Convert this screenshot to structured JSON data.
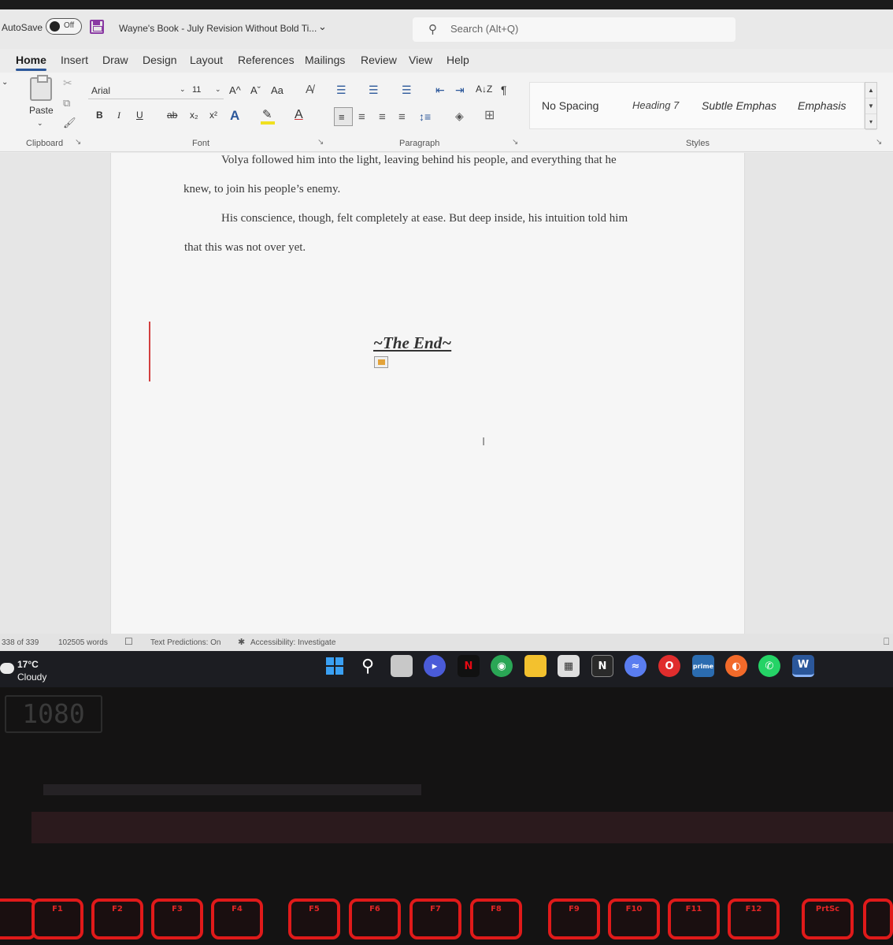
{
  "titlebar": {
    "autosave_label": "AutoSave",
    "autosave_state": "Off",
    "doc_title": "Wayne's Book - July Revision Without Bold Ti...",
    "title_chevron": "⌄",
    "search_placeholder": "Search (Alt+Q)"
  },
  "menu": [
    "Home",
    "Insert",
    "Draw",
    "Design",
    "Layout",
    "References",
    "Mailings",
    "Review",
    "View",
    "Help"
  ],
  "ribbon": {
    "paste_label": "Paste",
    "clipboard_label": "Clipboard",
    "font_name": "Arial",
    "font_size": "11",
    "font_label": "Font",
    "paragraph_label": "Paragraph",
    "styles_label": "Styles",
    "grow_font": "A^",
    "shrink_font": "Aˇ",
    "change_case": "Aa",
    "bold": "B",
    "italic": "I",
    "underline": "U",
    "strikethrough": "ab",
    "subscript": "x₂",
    "superscript": "x²",
    "text_effects": "A",
    "font_color": "A",
    "pilcrow": "¶",
    "sort": "A↓Z",
    "styles": [
      "No Spacing",
      "Heading 7",
      "Subtle Emphas",
      "Emphasis"
    ]
  },
  "document": {
    "line1": "Volya followed him into the light, leaving behind his people, and everything that he",
    "line2": "knew, to join his people’s enemy.",
    "line3": "His conscience, though, felt completely at ease. But deep inside, his intuition told him",
    "line4": "that this was not over yet.",
    "the_end": "~The End~"
  },
  "status": {
    "page": "338 of 339",
    "words": "102505 words",
    "predictions": "Text Predictions: On",
    "accessibility": "Accessibility: Investigate"
  },
  "taskbar": {
    "temp": "17°C",
    "condition": "Cloudy"
  },
  "led_display": "1080",
  "keyboard_keys": [
    "F1",
    "F2",
    "F3",
    "F4",
    "F5",
    "F6",
    "F7",
    "F8",
    "F9",
    "F10",
    "F11",
    "F12",
    "PrtSc"
  ],
  "colors": {
    "word_blue": "#2b579a",
    "keyboard_red": "#e01a1a",
    "taskbar": "#1c1d22"
  }
}
